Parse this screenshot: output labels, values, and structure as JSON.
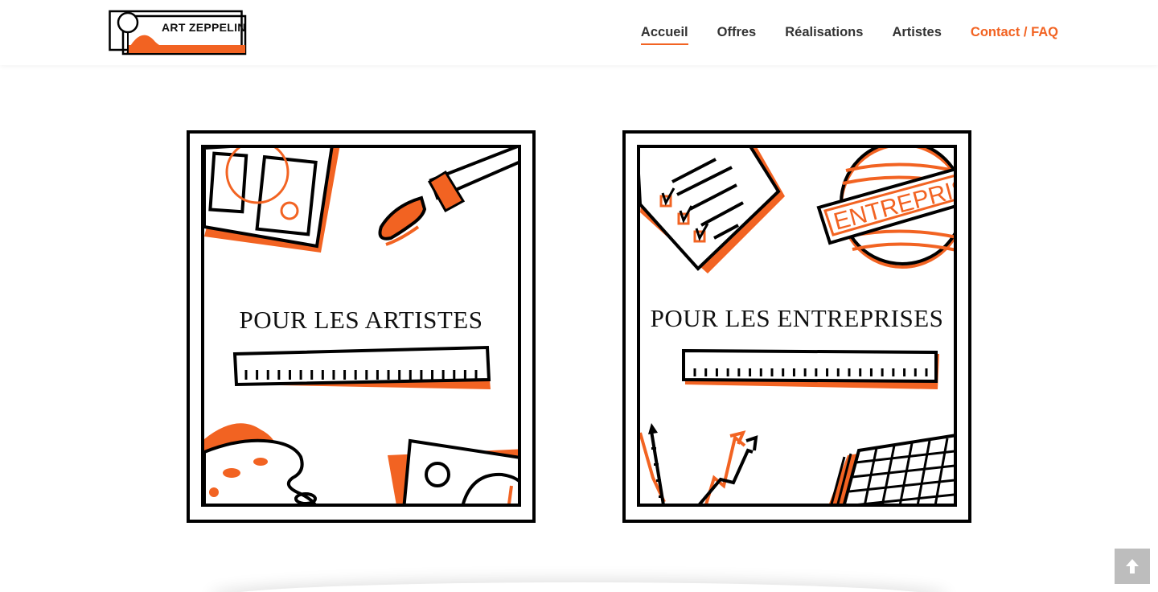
{
  "header": {
    "logo_text": "ART ZEPPELIN",
    "nav": [
      {
        "label": "Accueil"
      },
      {
        "label": "Offres"
      },
      {
        "label": "Réalisations"
      },
      {
        "label": "Artistes"
      },
      {
        "label": "Contact / FAQ"
      }
    ]
  },
  "cards": [
    {
      "title": "POUR LES ARTISTES"
    },
    {
      "title": "POUR LES ENTREPRISES",
      "stamp_text": "ENTREPRIS"
    }
  ],
  "colors": {
    "accent": "#f26322",
    "ink": "#000000",
    "scroll_button": "#bdbdbd"
  },
  "scroll_top": {
    "icon": "arrow-up-icon"
  }
}
